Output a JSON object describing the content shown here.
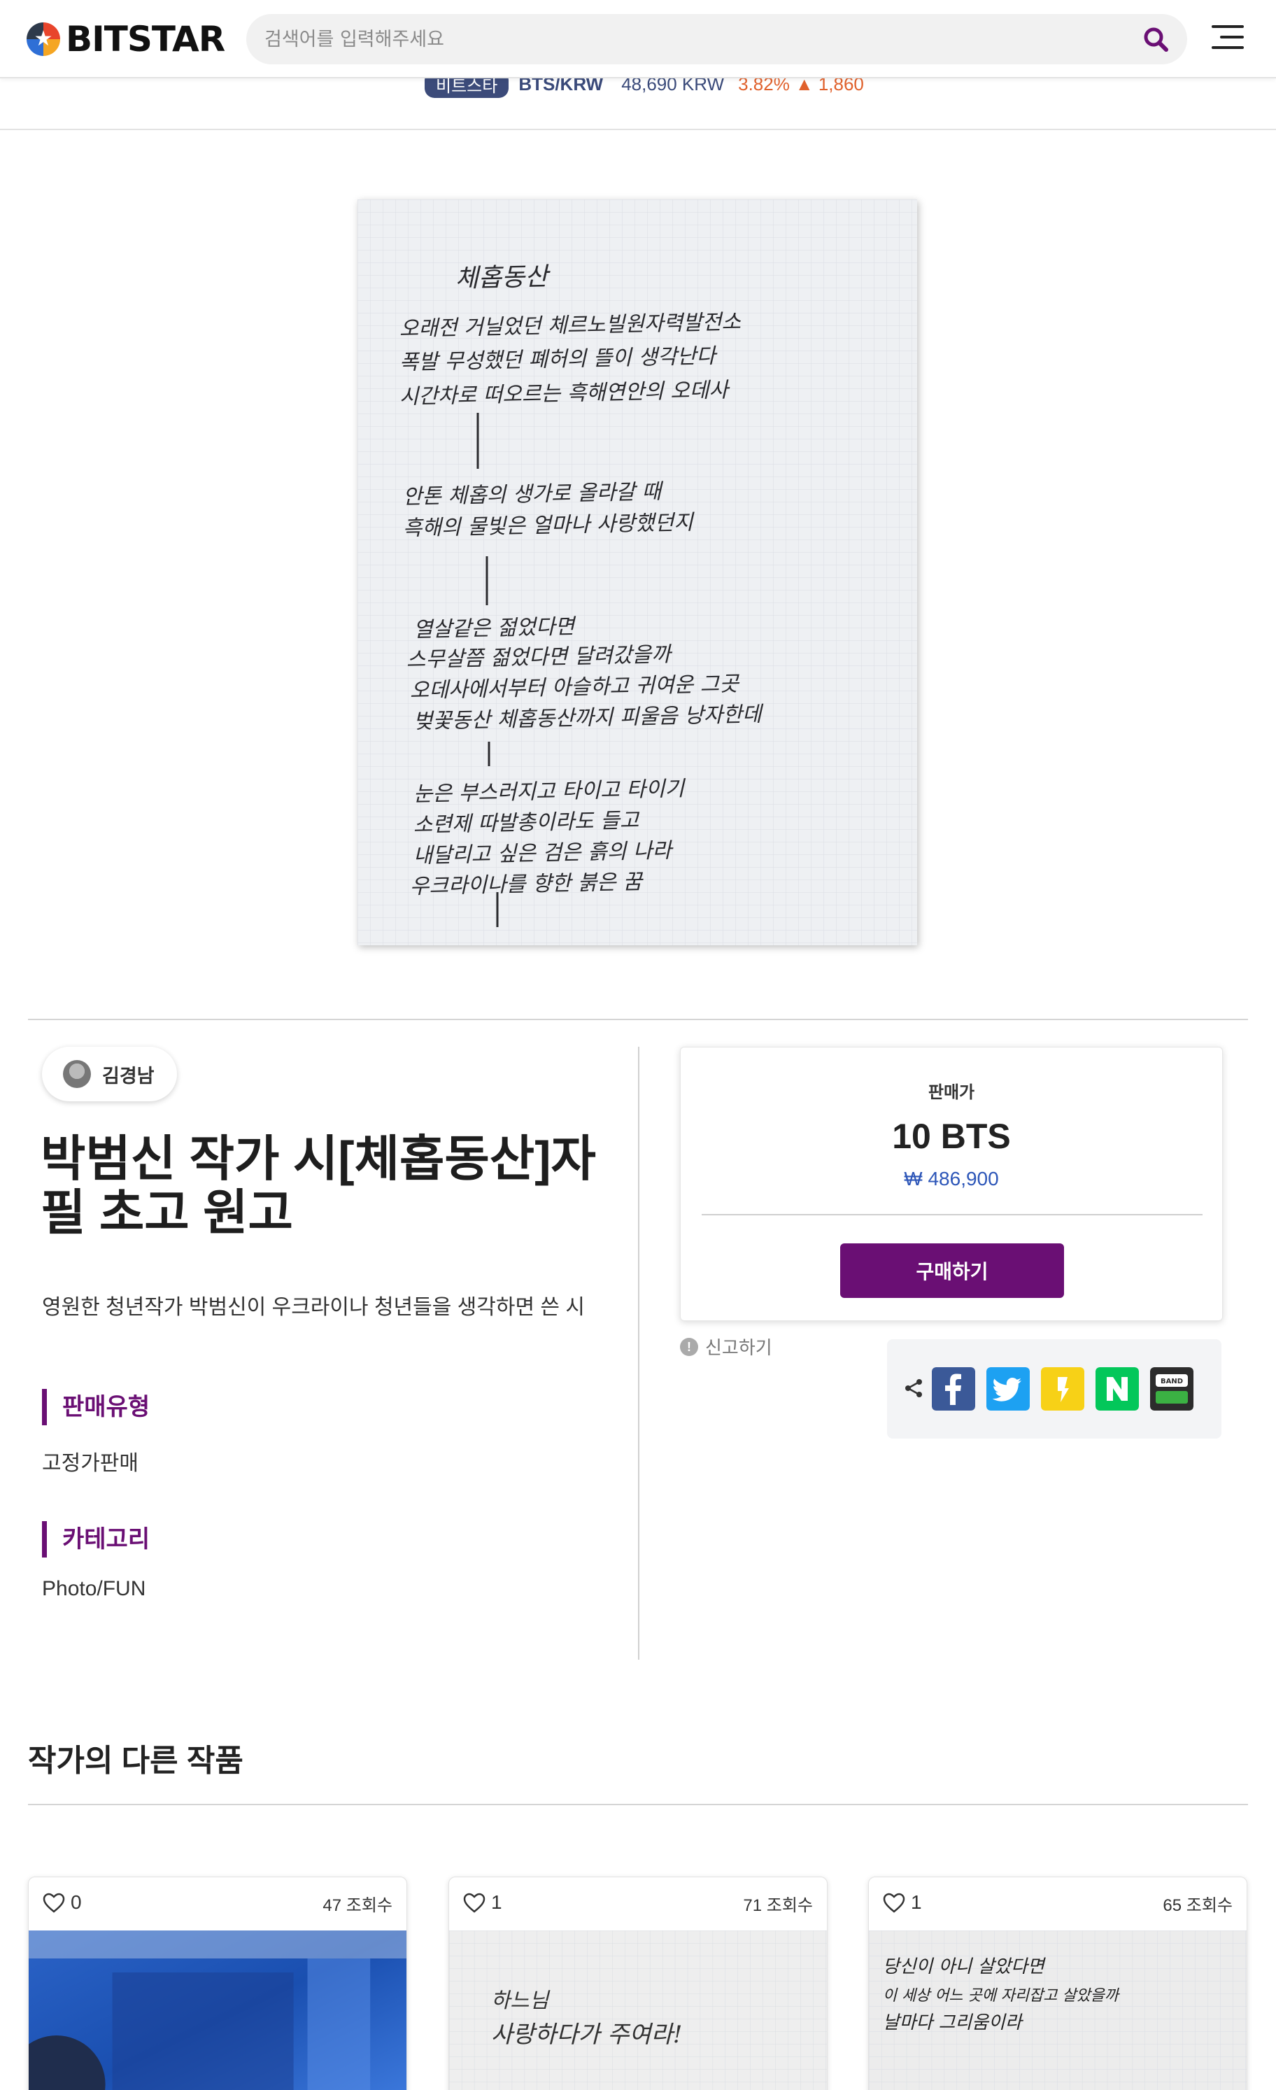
{
  "header": {
    "logo_text": "BITSTAR",
    "search_placeholder": "검색어를 입력해주세요"
  },
  "ticker": {
    "badge": "비트스타",
    "pair": "BTS/KRW",
    "price": "48,690 KRW",
    "change_pct": "3.82%",
    "change_value": "▲ 1,860"
  },
  "artwork": {
    "lines": [
      "체홉동산",
      "오래전 거닐었던 체르노빌원자력발전소",
      "폭발 무성했던 폐허의 뜰이 생각난다",
      "시간차로 떠오르는 흑해연안의 오데사",
      "안톤 체홉의 생가로 올라갈 때",
      "흑해의 물빛은 얼마나 사랑했던지",
      "열살같은 젊었다면",
      "스무살쯤 젊었다면 달려갔을까",
      "오데사에서부터 아슬하고 귀여운 그곳",
      "벚꽃동산 체홉동산까지 피울음 낭자한데",
      "눈은 부스러지고 타이고 타이기",
      "소련제 따발총이라도 들고",
      "내달리고 싶은 검은 흙의 나라",
      "우크라이나를 향한 붉은 꿈"
    ]
  },
  "author": {
    "name": "김경남"
  },
  "product": {
    "title": "박범신 작가 시[체홉동산]자필 초고 원고",
    "description": "영원한 청년작가 박범신이 우크라이나 청년들을 생각하면 쓴 시",
    "sale_type_label": "판매유형",
    "sale_type_value": "고정가판매",
    "category_label": "카테고리",
    "category_value": "Photo/FUN"
  },
  "price_card": {
    "label": "판매가",
    "price": "10 BTS",
    "krw": "₩ 486,900",
    "buy_label": "구매하기"
  },
  "report_label": "신고하기",
  "share": {
    "icons": [
      "share-icon",
      "facebook-icon",
      "twitter-icon",
      "kakaostory-icon",
      "naver-icon",
      "band-icon"
    ],
    "band_text": "BAND",
    "naver_text": "N",
    "colors": {
      "facebook": "#3b5998",
      "twitter": "#1da1f2",
      "kakaostory": "#f7d117",
      "naver": "#03c75a",
      "band": "#2c2c2c"
    }
  },
  "other_works": {
    "title": "작가의 다른 작품",
    "cards": [
      {
        "likes": "0",
        "views": "47 조회수"
      },
      {
        "likes": "1",
        "views": "71 조회수"
      },
      {
        "likes": "1",
        "views": "65 조회수"
      }
    ],
    "card2_text_lines": [
      "하느님",
      "사랑하다가 주여라!"
    ],
    "card3_text_lines": [
      "당신이 아니 살았다면",
      "이 세상 어느 곳에 자리잡고 살았을까",
      "날마다 그리움이라"
    ]
  },
  "colors": {
    "brand_purple": "#6a0f74",
    "ticker_badge": "#3c4b7a",
    "ticker_up": "#e0612c",
    "krw_blue": "#2d56b8"
  }
}
